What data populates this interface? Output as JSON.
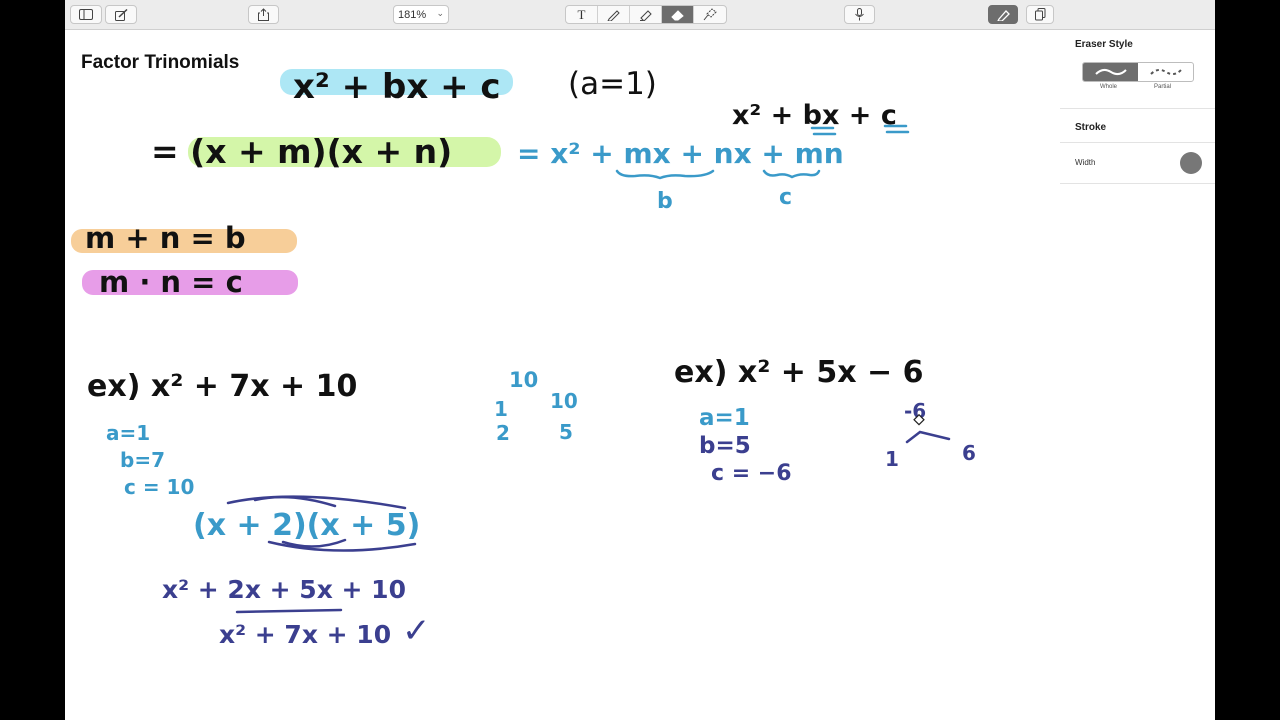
{
  "toolbar": {
    "zoom": "181%",
    "buttons": [
      "sidebar-toggle",
      "compose",
      "share",
      "text-tool",
      "pen-tool",
      "highlighter-tool",
      "eraser-tool",
      "lasso-tool",
      "microphone",
      "pencil-tip",
      "page-view"
    ]
  },
  "document": {
    "title": "Factor Trinomials"
  },
  "sidebar": {
    "eraser_style_title": "Eraser Style",
    "eraser_options": [
      "Whole",
      "Partial"
    ],
    "eraser_selected": "Whole",
    "stroke_title": "Stroke",
    "width_label": "Width"
  },
  "ink": {
    "formula": "x² + bx + c",
    "condition": "(a=1)",
    "formula_repeat": "x² + bx + c",
    "eq_lhs": "= (x + m)(x + n)",
    "eq_rhs": "= x² + mx + nx + mn",
    "b_label": "b",
    "c_label": "c",
    "sum_rule": "m + n = b",
    "product_rule": "m · n = c",
    "ex1": "ex)  x² + 7x + 10",
    "ex1_a": "a=1",
    "ex1_b": "b=7",
    "ex1_c": "c = 10",
    "ex1_factor": "(x + 2)(x + 5)",
    "ex1_expand": "x² + 2x + 5x + 10",
    "ex1_result": "x² + 7x + 10",
    "check": "✓",
    "f_top": "10",
    "f_1": "1",
    "f_10": "10",
    "f_2": "2",
    "f_5": "5",
    "ex2": "ex)  x² + 5x − 6",
    "ex2_a": "a=1",
    "ex2_b": "b=5",
    "ex2_c": "c = −6",
    "f2_top": "-6",
    "f2_1": "1",
    "f2_6": "6"
  },
  "colors": {
    "ink_black": "#111111",
    "ink_blue": "#3a9ac9",
    "ink_navy": "#3b3f8f",
    "hl_cyan": "#9fe3f3",
    "hl_green": "#cdf59a",
    "hl_orange": "#f6c98e",
    "hl_magenta": "#e38ce4"
  }
}
